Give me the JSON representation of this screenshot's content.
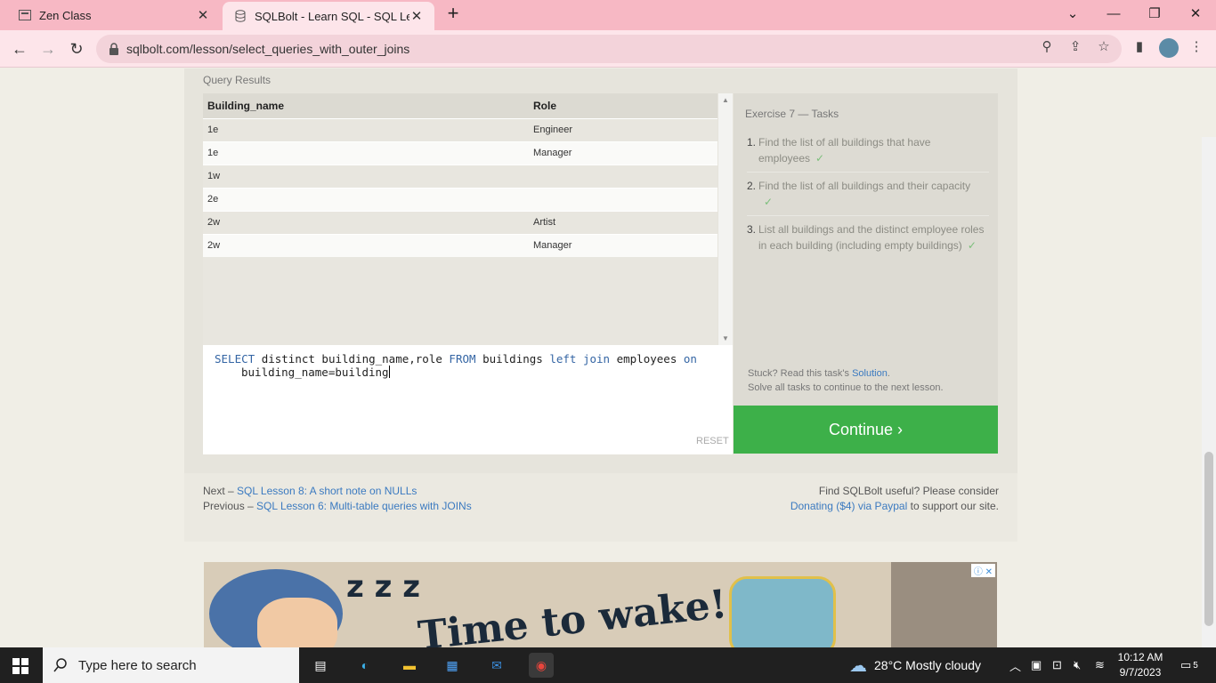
{
  "browser": {
    "tabs": [
      {
        "title": "Zen Class",
        "icon": "zen-class-favicon"
      },
      {
        "title": "SQLBolt - Learn SQL - SQL Lesson",
        "icon": "database-favicon"
      }
    ],
    "url": "sqlbolt.com/lesson/select_queries_with_outer_joins"
  },
  "results": {
    "label": "Query Results",
    "columns": [
      "Building_name",
      "Role"
    ],
    "rows": [
      [
        "1e",
        "Engineer"
      ],
      [
        "1e",
        "Manager"
      ],
      [
        "1w",
        ""
      ],
      [
        "2e",
        ""
      ],
      [
        "2w",
        "Artist"
      ],
      [
        "2w",
        "Manager"
      ]
    ]
  },
  "editor": {
    "line1": {
      "kw_select": "SELECT",
      "t1": "distinct building_name,role",
      "kw_from": "FROM",
      "t2": "buildings",
      "kw_left": "left",
      "kw_join": "join",
      "t3": "employees",
      "kw_on": "on"
    },
    "line2": "building_name=building",
    "reset_label": "RESET"
  },
  "tasks": {
    "title": "Exercise 7 — Tasks",
    "items": [
      {
        "num": "1.",
        "text": "Find the list of all buildings that have employees",
        "check": "✓"
      },
      {
        "num": "2.",
        "text": "Find the list of all buildings and their capacity",
        "check": "✓"
      },
      {
        "num": "3.",
        "text": "List all buildings and the distinct employee roles in each building (including empty buildings)",
        "check": "✓"
      }
    ],
    "stuck_prefix": "Stuck? Read this task's",
    "solution_link": "Solution",
    "stuck_suffix": ".",
    "stuck_line2": "Solve all tasks to continue to the next lesson.",
    "continue_label": "Continue ›"
  },
  "footer": {
    "next_prefix": "Next –",
    "next_link": "SQL Lesson 8: A short note on NULLs",
    "prev_prefix": "Previous –",
    "prev_link": "SQL Lesson 6: Multi-table queries with JOINs",
    "donate_line1": "Find SQLBolt useful? Please consider",
    "donate_link": "Donating ($4) via Paypal",
    "donate_suffix": "to support our site."
  },
  "ad": {
    "zzz": "z z z",
    "headline": "Time to wake!",
    "badge": "ⓘ ✕"
  },
  "taskbar": {
    "search_placeholder": "Type here to search",
    "weather": "28°C  Mostly cloudy",
    "time": "10:12 AM",
    "date": "9/7/2023",
    "notifications": "5"
  }
}
